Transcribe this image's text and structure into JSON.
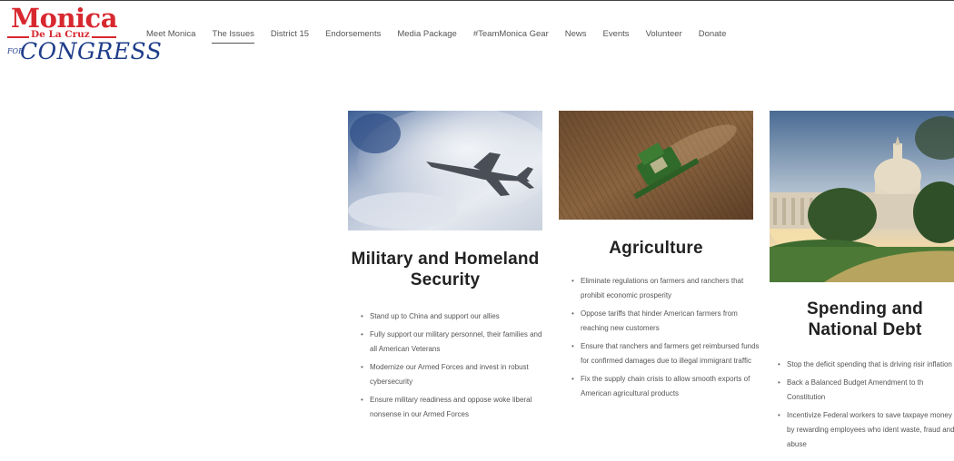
{
  "logo": {
    "name": "Monica",
    "subname": "De La Cruz",
    "for": "FOR",
    "office": "CONGRESS"
  },
  "nav": {
    "items": [
      {
        "label": "Meet Monica"
      },
      {
        "label": "The Issues",
        "active": true
      },
      {
        "label": "District 15"
      },
      {
        "label": "Endorsements"
      },
      {
        "label": "Media Package"
      },
      {
        "label": "#TeamMonica Gear"
      },
      {
        "label": "News"
      },
      {
        "label": "Events"
      },
      {
        "label": "Volunteer"
      },
      {
        "label": "Donate"
      }
    ]
  },
  "issues": [
    {
      "title": "Military and Homeland Security",
      "image": "fighter-jet-photo",
      "points": [
        "Stand up to China and support our allies",
        "Fully support our military personnel, their families and all American Veterans",
        "Modernize our Armed Forces and invest in robust cybersecurity",
        "Ensure military readiness and oppose woke liberal nonsense in our Armed Forces"
      ]
    },
    {
      "title": "Agriculture",
      "image": "combine-harvester-field-photo",
      "points": [
        "Eliminate regulations on farmers and ranchers that prohibit economic prosperity",
        "Oppose tariffs that hinder American farmers from reaching new customers",
        "Ensure that ranchers and farmers get reimbursed funds for confirmed damages due to illegal immigrant traffic",
        "Fix the supply chain crisis to allow smooth exports of American agricultural products"
      ]
    },
    {
      "title": "Spending and National Debt",
      "image": "us-capitol-photo",
      "points": [
        "Stop the deficit spending that is driving risir inflation",
        "Back a Balanced Budget Amendment to th Constitution",
        "Incentivize Federal workers to save taxpaye money by rewarding employees who ident waste, fraud and abuse"
      ]
    }
  ],
  "colors": {
    "brand_red": "#d8282f",
    "brand_blue": "#1f3d8a",
    "nav_text": "#555555",
    "heading": "#222222"
  }
}
